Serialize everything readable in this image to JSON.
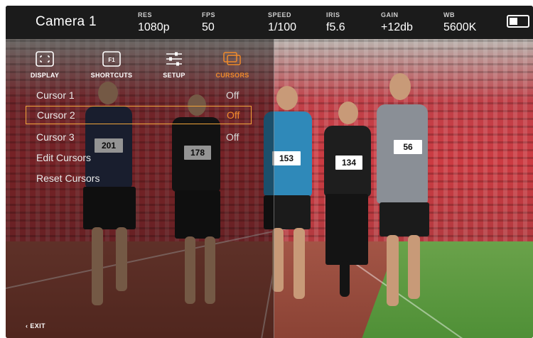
{
  "camera": {
    "title": "Camera 1"
  },
  "stats": [
    {
      "label": "RES",
      "value": "1080p"
    },
    {
      "label": "FPS",
      "value": "50"
    },
    {
      "label": "SPEED",
      "value": "1/100"
    },
    {
      "label": "IRIS",
      "value": "f5.6"
    },
    {
      "label": "GAIN",
      "value": "+12db"
    },
    {
      "label": "WB",
      "value": "5600K"
    }
  ],
  "nav": [
    {
      "label": "DISPLAY",
      "icon": "display-icon"
    },
    {
      "label": "SHORTCUTS",
      "icon": "f1-icon"
    },
    {
      "label": "SETUP",
      "icon": "sliders-icon"
    },
    {
      "label": "CURSORS",
      "icon": "cursors-icon"
    }
  ],
  "menu": [
    {
      "name": "Cursor 1",
      "value": "Off"
    },
    {
      "name": "Cursor 2",
      "value": "Off"
    },
    {
      "name": "Cursor 3",
      "value": "Off"
    },
    {
      "name": "Edit Cursors",
      "value": ""
    },
    {
      "name": "Reset Cursors",
      "value": ""
    }
  ],
  "runners": [
    {
      "bib": "201"
    },
    {
      "bib": "178"
    },
    {
      "bib": "153"
    },
    {
      "bib": "134"
    },
    {
      "bib": "56"
    }
  ],
  "exit": {
    "label": "EXIT"
  },
  "colors": {
    "accent": "#f08a2a",
    "selection": "#f0a53a",
    "topbar": "#1b1b1b"
  }
}
